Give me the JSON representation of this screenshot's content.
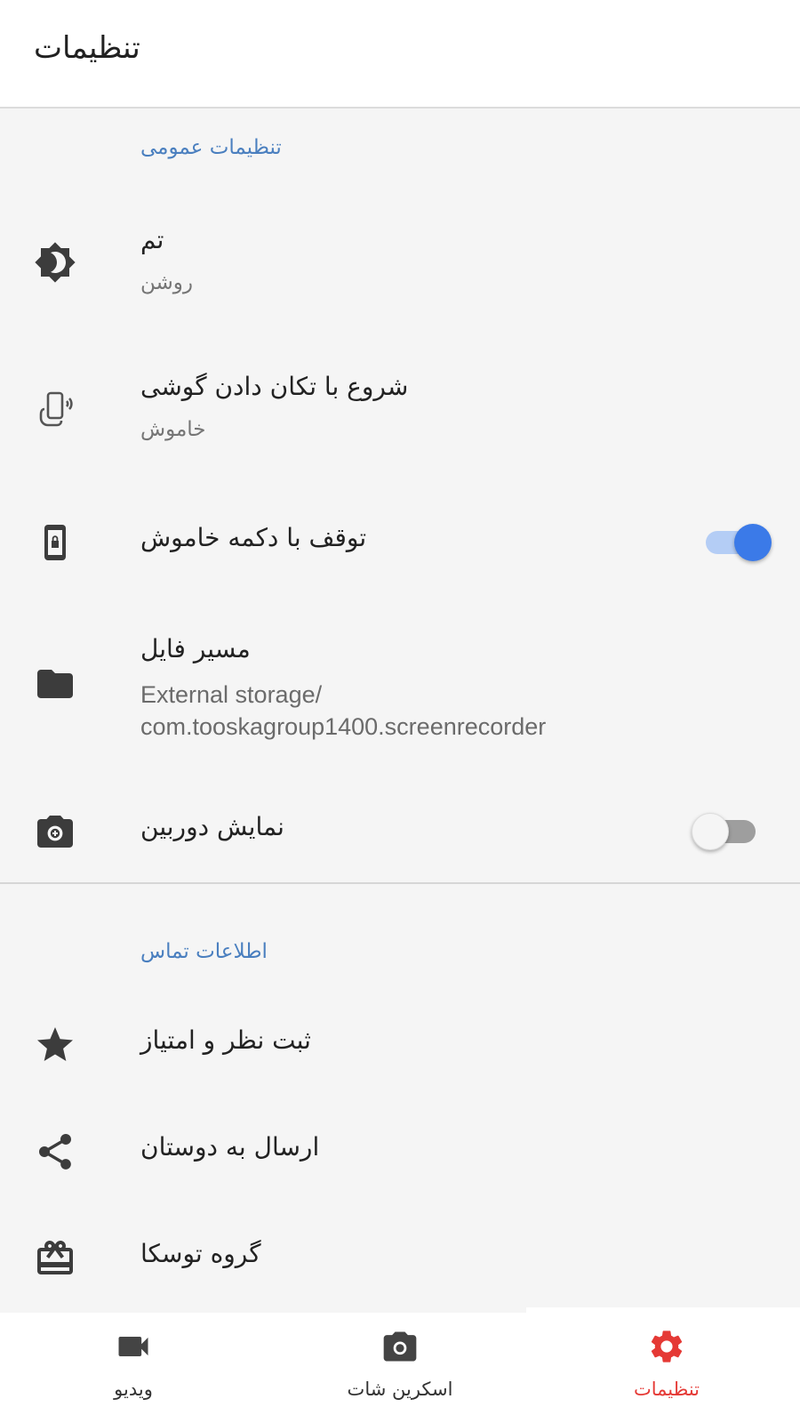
{
  "app_bar": {
    "title": "تنظیمات"
  },
  "general_section": {
    "header": "تنظیمات عمومی",
    "theme": {
      "title": "تم",
      "value": "روشن",
      "icon": "theme-brightness-icon"
    },
    "shake_start": {
      "title": "شروع با تکان دادن گوشی",
      "value": "خاموش",
      "icon": "shake-phone-icon"
    },
    "power_stop": {
      "title": "توقف با دکمه خاموش",
      "enabled": true,
      "icon": "phone-lock-icon"
    },
    "file_path": {
      "title": "مسیر فایل",
      "value_line1": "External storage/",
      "value_line2": "com.tooskagroup1400.screenrecorder",
      "icon": "folder-icon"
    },
    "show_camera": {
      "title": "نمایش دوربین",
      "enabled": false,
      "icon": "camera-front-icon"
    }
  },
  "contact_section": {
    "header": "اطلاعات تماس",
    "rate": {
      "title": "ثبت نظر و امتیاز",
      "icon": "star-icon"
    },
    "share": {
      "title": "ارسال به دوستان",
      "icon": "share-icon"
    },
    "group": {
      "title": "گروه توسکا",
      "icon": "gift-icon"
    }
  },
  "bottom_nav": {
    "items": [
      {
        "label": "ویدیو",
        "icon": "videocam-icon",
        "active": false
      },
      {
        "label": "اسکرین شات",
        "icon": "camera-icon",
        "active": false
      },
      {
        "label": "تنظیمات",
        "icon": "settings-gear-icon",
        "active": true
      }
    ]
  },
  "colors": {
    "accent_blue": "#3b7ae8",
    "section_header": "#4a7fbf",
    "active_nav": "#e53935",
    "background": "#f5f5f5"
  }
}
